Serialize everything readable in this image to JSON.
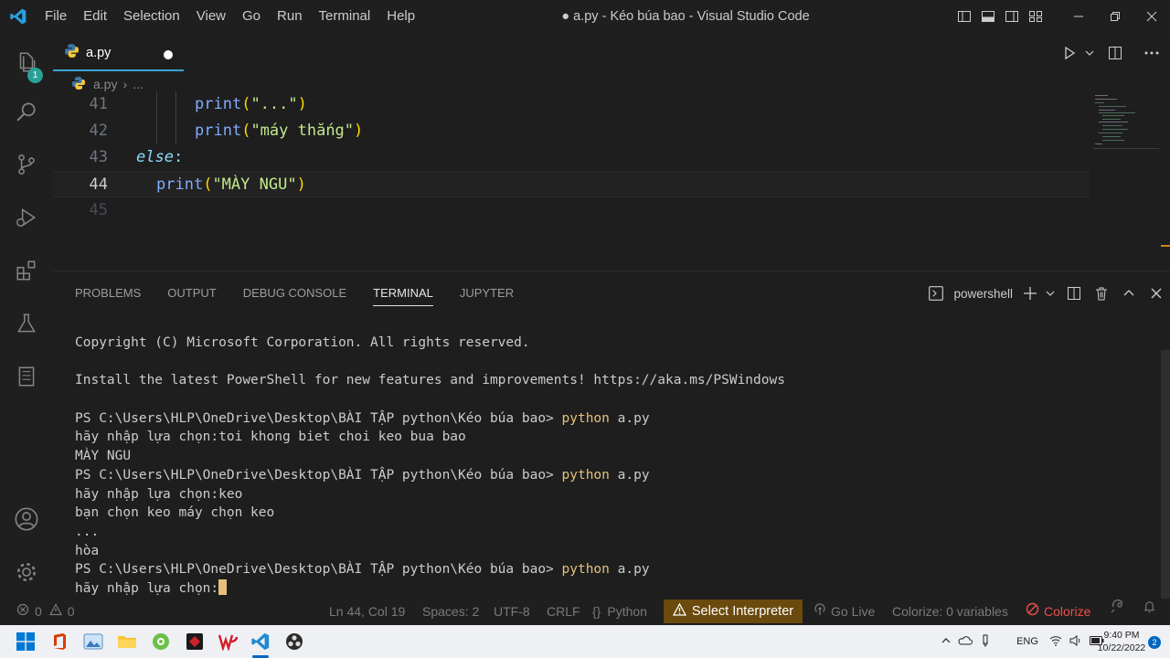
{
  "window": {
    "title": "● a.py - Kéo búa bao - Visual Studio Code",
    "menu": [
      "File",
      "Edit",
      "Selection",
      "View",
      "Go",
      "Run",
      "Terminal",
      "Help"
    ]
  },
  "activity_bar": {
    "explorer_badge": "1"
  },
  "editor": {
    "tab_label": "a.py",
    "breadcrumb": {
      "file": "a.py",
      "rest": "..."
    },
    "lines": [
      {
        "num": "41",
        "fn": "print",
        "open": "(",
        "str": "\"...\"",
        "close": ")"
      },
      {
        "num": "42",
        "fn": "print",
        "open": "(",
        "str": "\"máy thắng\"",
        "close": ")"
      },
      {
        "num": "43",
        "kw": "else",
        "colon": ":"
      },
      {
        "num": "44",
        "fn": "print",
        "open": "(",
        "str": "\"MÀY NGU\"",
        "close": ")"
      },
      {
        "num": "45"
      }
    ]
  },
  "panel": {
    "tabs": [
      "PROBLEMS",
      "OUTPUT",
      "DEBUG CONSOLE",
      "TERMINAL",
      "JUPYTER"
    ],
    "active_tab": "TERMINAL",
    "shell": "powershell",
    "terminal": {
      "copyright": "Copyright (C) Microsoft Corporation. All rights reserved.",
      "install": "Install the latest PowerShell for new features and improvements! https://aka.ms/PSWindows",
      "prompt": "PS C:\\Users\\HLP\\OneDrive\\Desktop\\BÀI TẬP python\\Kéo búa bao> ",
      "cmd": "python",
      "arg": " a.py",
      "out1": "hãy nhập lựa chọn:toi khong biet choi keo bua bao",
      "out2": "MÀY NGU",
      "out3": "hãy nhập lựa chọn:keo",
      "out4": "bạn chọn keo máy chọn keo",
      "out5": "...",
      "out6": "hòa",
      "out7": "hãy nhập lựa chọn:"
    }
  },
  "status_bar": {
    "errors": "0",
    "warnings": "0",
    "position": "Ln 44, Col 19",
    "spaces": "Spaces: 2",
    "encoding": "UTF-8",
    "eol": "CRLF",
    "language": "Python",
    "interpreter": "Select Interpreter",
    "go_live": "Go Live",
    "colorize_vars": "Colorize: 0 variables",
    "colorize": "Colorize"
  },
  "taskbar": {
    "language": "ENG",
    "time": "9:40 PM",
    "date": "10/22/2022",
    "notifications": "2"
  },
  "colors": {
    "accent": "#3aa4d8",
    "warning_bg": "#6b4a0d",
    "colorize_red": "#f14c4c",
    "terminal_command": "#e5c07b"
  }
}
